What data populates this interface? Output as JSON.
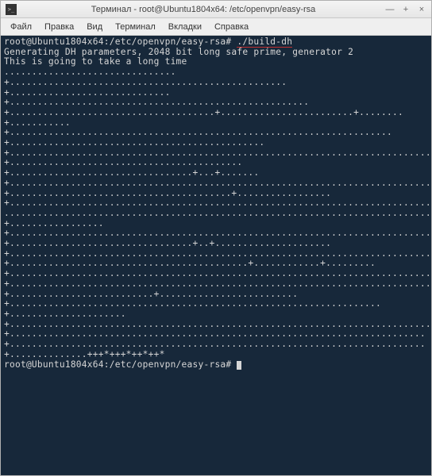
{
  "titlebar": {
    "title": "Терминал - root@Ubuntu1804x64: /etc/openvpn/easy-rsa",
    "minimize": "—",
    "maximize": "+",
    "close": "×"
  },
  "menubar": {
    "file": "Файл",
    "edit": "Правка",
    "view": "Вид",
    "terminal": "Терминал",
    "tabs": "Вкладки",
    "help": "Справка"
  },
  "terminal": {
    "prompt1": "root@Ubuntu1804x64:/etc/openvpn/easy-rsa# ",
    "cmd1": "./build-dh",
    "line1": "Generating DH parameters, 2048 bit long safe prime, generator 2",
    "line2": "This is going to take a long time",
    "progress": "...............................+..................................................+.............................+......................................................+.....................................+........................+........+...........+.....................................................................+..............................................+...........................................................................................................................................................................................................+..........................................+.................................+...+.......+................................................................................................................................................................+........................................+.................+..........................................................................................................................................., ...........................................................................................................................+.................+.................................................................................................+.................................+..+.....................+.........................................................................................+...........................................+............+.........+....................................................................................+.........................................................................................................................................................+..........................+.........................+...................................................................+.....................+.................................................................................................................................................+...........................................................................+...........................................................................+..............+++*+++*++*++*",
    "prompt2": "root@Ubuntu1804x64:/etc/openvpn/easy-rsa# "
  }
}
